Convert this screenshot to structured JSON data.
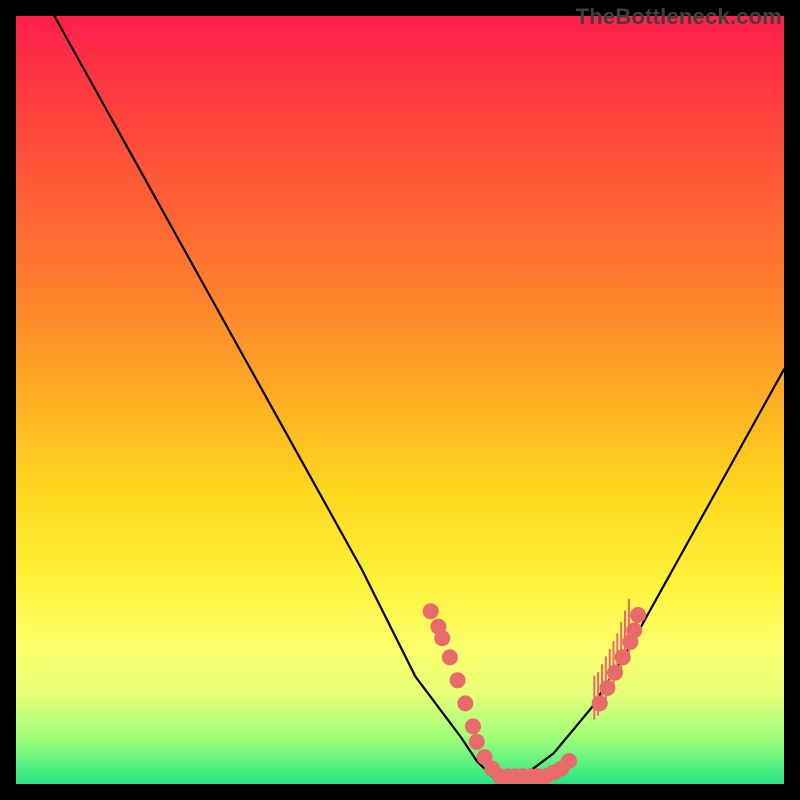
{
  "watermark": "TheBottleneck.com",
  "chart_data": {
    "type": "line",
    "title": "",
    "xlabel": "",
    "ylabel": "",
    "xlim": [
      0,
      100
    ],
    "ylim": [
      0,
      100
    ],
    "series": [
      {
        "name": "curve",
        "x": [
          5,
          10,
          15,
          20,
          25,
          30,
          35,
          40,
          45,
          48,
          50,
          52,
          55,
          58,
          60,
          62,
          64,
          66,
          70,
          75,
          80,
          85,
          90,
          95,
          100
        ],
        "y": [
          100,
          91,
          82,
          73,
          64,
          55,
          46,
          37,
          28,
          22,
          18,
          14,
          10,
          6,
          3,
          1,
          0,
          1,
          4,
          10,
          18,
          27,
          36,
          45,
          54
        ]
      }
    ],
    "markers": {
      "name": "highlight-dots",
      "color": "#e86a6a",
      "points": [
        {
          "x": 54.0,
          "y": 22.5
        },
        {
          "x": 55.0,
          "y": 20.5
        },
        {
          "x": 55.5,
          "y": 19.0
        },
        {
          "x": 56.5,
          "y": 16.5
        },
        {
          "x": 57.5,
          "y": 13.5
        },
        {
          "x": 58.5,
          "y": 10.5
        },
        {
          "x": 59.5,
          "y": 7.5
        },
        {
          "x": 60.0,
          "y": 5.5
        },
        {
          "x": 61.0,
          "y": 3.5
        },
        {
          "x": 62.0,
          "y": 2.0
        },
        {
          "x": 63.0,
          "y": 1.0
        },
        {
          "x": 64.0,
          "y": 1.0
        },
        {
          "x": 65.0,
          "y": 1.0
        },
        {
          "x": 66.0,
          "y": 1.0
        },
        {
          "x": 67.0,
          "y": 1.0
        },
        {
          "x": 68.0,
          "y": 1.0
        },
        {
          "x": 69.0,
          "y": 1.0
        },
        {
          "x": 70.0,
          "y": 1.5
        },
        {
          "x": 71.0,
          "y": 2.0
        },
        {
          "x": 72.0,
          "y": 3.0
        },
        {
          "x": 76.0,
          "y": 10.5
        },
        {
          "x": 77.0,
          "y": 12.5
        },
        {
          "x": 78.0,
          "y": 14.5
        },
        {
          "x": 79.0,
          "y": 16.5
        },
        {
          "x": 80.0,
          "y": 18.5
        },
        {
          "x": 80.5,
          "y": 20.0
        },
        {
          "x": 81.0,
          "y": 22.0
        }
      ]
    },
    "ticks": {
      "name": "salmon-ticks",
      "color": "#e86a6a",
      "points": [
        {
          "x": 75.3,
          "y_top": 14.0,
          "y_bot": 8.5
        },
        {
          "x": 75.8,
          "y_top": 14.5,
          "y_bot": 9.0
        },
        {
          "x": 76.3,
          "y_top": 15.5,
          "y_bot": 10.0
        },
        {
          "x": 76.8,
          "y_top": 16.5,
          "y_bot": 11.0
        },
        {
          "x": 77.3,
          "y_top": 17.5,
          "y_bot": 12.0
        },
        {
          "x": 77.8,
          "y_top": 18.5,
          "y_bot": 13.0
        },
        {
          "x": 78.3,
          "y_top": 19.5,
          "y_bot": 14.0
        },
        {
          "x": 78.8,
          "y_top": 21.0,
          "y_bot": 15.0
        },
        {
          "x": 79.3,
          "y_top": 22.5,
          "y_bot": 16.0
        },
        {
          "x": 79.8,
          "y_top": 24.0,
          "y_bot": 17.0
        }
      ]
    }
  }
}
